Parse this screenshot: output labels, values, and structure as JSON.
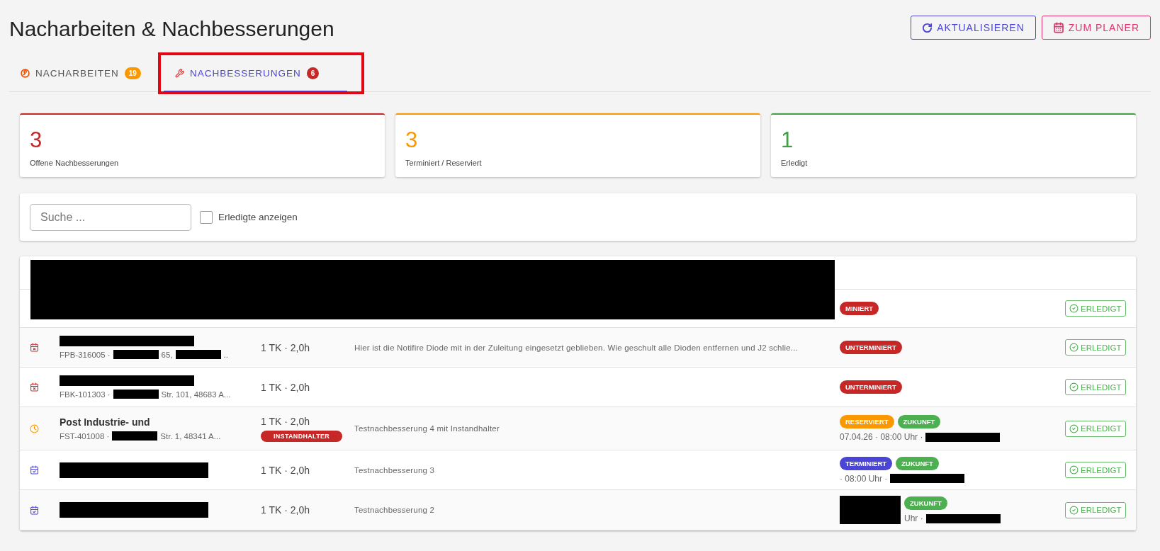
{
  "title": "Nacharbeiten & Nachbesserungen",
  "actions": [
    {
      "label": "AKTUALISIEREN",
      "kind": "refresh",
      "color": "#4a45d6"
    },
    {
      "label": "ZUM PLANER",
      "kind": "calendar",
      "color": "#e0336b"
    }
  ],
  "tabs": [
    {
      "label": "NACHARBEITEN",
      "count": "19",
      "kind": "rework",
      "color": "#fb9800",
      "selected": false
    },
    {
      "label": "NACHBESSERUNGEN",
      "count": "6",
      "kind": "repair",
      "color": "#c62828",
      "selected": true
    }
  ],
  "stats": [
    {
      "value": "3",
      "label": "Offene Nachbesserungen",
      "color": "#c62828"
    },
    {
      "value": "3",
      "label": "Terminiert / Reserviert",
      "color": "#fb9800"
    },
    {
      "value": "1",
      "label": "Erledigt",
      "color": "#43a047"
    }
  ],
  "filter": {
    "search_placeholder": "Suche ...",
    "checkbox_label": "Erledigte anzeigen",
    "checked": false
  },
  "rows": [
    {
      "kind": "none",
      "name": null,
      "sub_parts": [],
      "effort": null,
      "tag": null,
      "description": null,
      "badges": [
        {
          "text": "MINIERT",
          "color": "#c62828"
        }
      ],
      "date_parts": [],
      "button": "ERLEDIGT"
    },
    {
      "kind": "calendar-x",
      "name": null,
      "sub_parts": [
        "FPB-316005 ·",
        "65,",
        ".."
      ],
      "effort": "1 TK · 2,0h",
      "tag": null,
      "description": "Hier ist die Notifire Diode mit in der Zuleitung eingesetzt geblieben. Wie geschult alle Dioden entfernen und J2 schlie...",
      "badges": [
        {
          "text": "UNTERMINIERT",
          "color": "#c62828"
        }
      ],
      "date_parts": [],
      "button": "ERLEDIGT"
    },
    {
      "kind": "calendar-x",
      "name": null,
      "sub_parts": [
        "FBK-101303 ·",
        "Str. 101, 48683 A..."
      ],
      "effort": "1 TK · 2,0h",
      "tag": null,
      "description": null,
      "badges": [
        {
          "text": "UNTERMINIERT",
          "color": "#c62828"
        }
      ],
      "date_parts": [],
      "button": "ERLEDIGT"
    },
    {
      "kind": "clock",
      "name": "Post Industrie- und",
      "sub_parts": [
        "FST-401008 ·",
        "Str. 1, 48341 A..."
      ],
      "effort": "1 TK · 2,0h",
      "tag": "INSTANDHALTER",
      "description": "Testnachbesserung 4 mit Instandhalter",
      "badges": [
        {
          "text": "RESERVIERT",
          "color": "#fb9800"
        },
        {
          "text": "ZUKUNFT",
          "color": "#4caf50"
        }
      ],
      "date_parts": [
        "07.04.26 · 08:00 Uhr ·"
      ],
      "button": "ERLEDIGT"
    },
    {
      "kind": "calendar-check",
      "name": null,
      "sub_parts": [],
      "effort": "1 TK · 2,0h",
      "tag": null,
      "description": "Testnachbesserung 3",
      "badges": [
        {
          "text": "TERMINIERT",
          "color": "#4a45d6"
        },
        {
          "text": "ZUKUNFT",
          "color": "#4caf50"
        }
      ],
      "date_parts": [
        "· 08:00 Uhr ·"
      ],
      "button": "ERLEDIGT"
    },
    {
      "kind": "calendar-check",
      "name": null,
      "sub_parts": [],
      "effort": "1 TK · 2,0h",
      "tag": null,
      "description": "Testnachbesserung 2",
      "badges": [
        {
          "text": "ZUKUNFT",
          "color": "#4caf50"
        }
      ],
      "date_parts": [
        "Uhr ·"
      ],
      "button": "ERLEDIGT"
    }
  ]
}
